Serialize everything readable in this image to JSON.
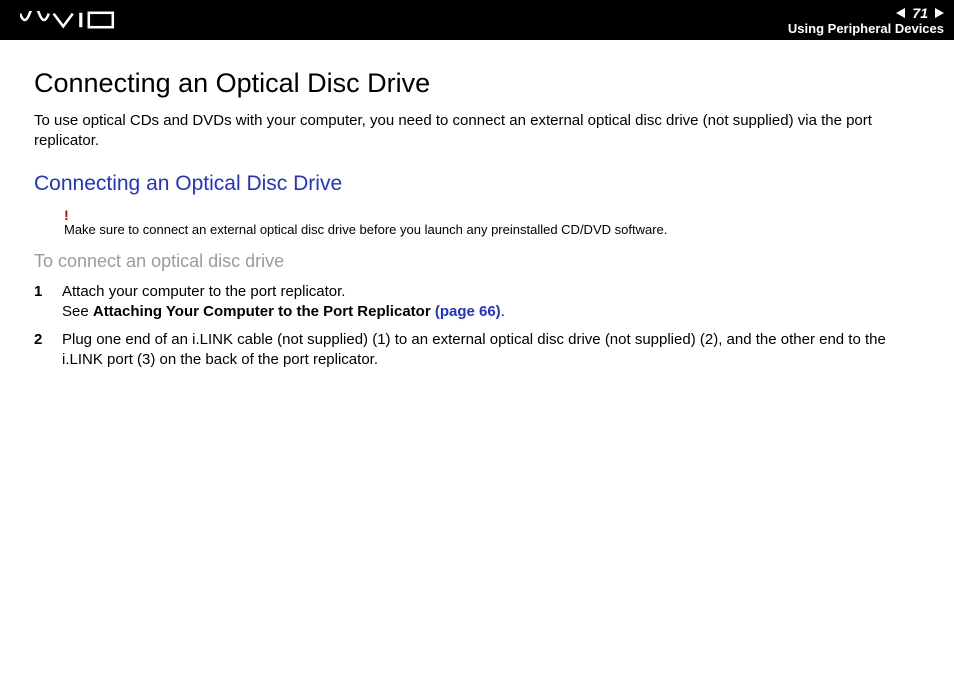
{
  "header": {
    "page_number": "71",
    "section": "Using Peripheral Devices"
  },
  "title": "Connecting an Optical Disc Drive",
  "intro": "To use optical CDs and DVDs with your computer, you need to connect an external optical disc drive (not supplied) via the port replicator.",
  "subtitle": "Connecting an Optical Disc Drive",
  "warning": {
    "mark": "!",
    "text": "Make sure to connect an external optical disc drive before you launch any preinstalled CD/DVD software."
  },
  "procedure_heading": "To connect an optical disc drive",
  "steps": {
    "s1": {
      "num": "1",
      "line1": "Attach your computer to the port replicator.",
      "line2_prefix": "See ",
      "line2_bold": "Attaching Your Computer to the Port Replicator ",
      "line2_link": "(page 66)",
      "line2_suffix": "."
    },
    "s2": {
      "num": "2",
      "text": "Plug one end of an i.LINK cable (not supplied) (1) to an external optical disc drive (not supplied) (2), and the other end to the i.LINK port (3) on the back of the port replicator."
    }
  }
}
